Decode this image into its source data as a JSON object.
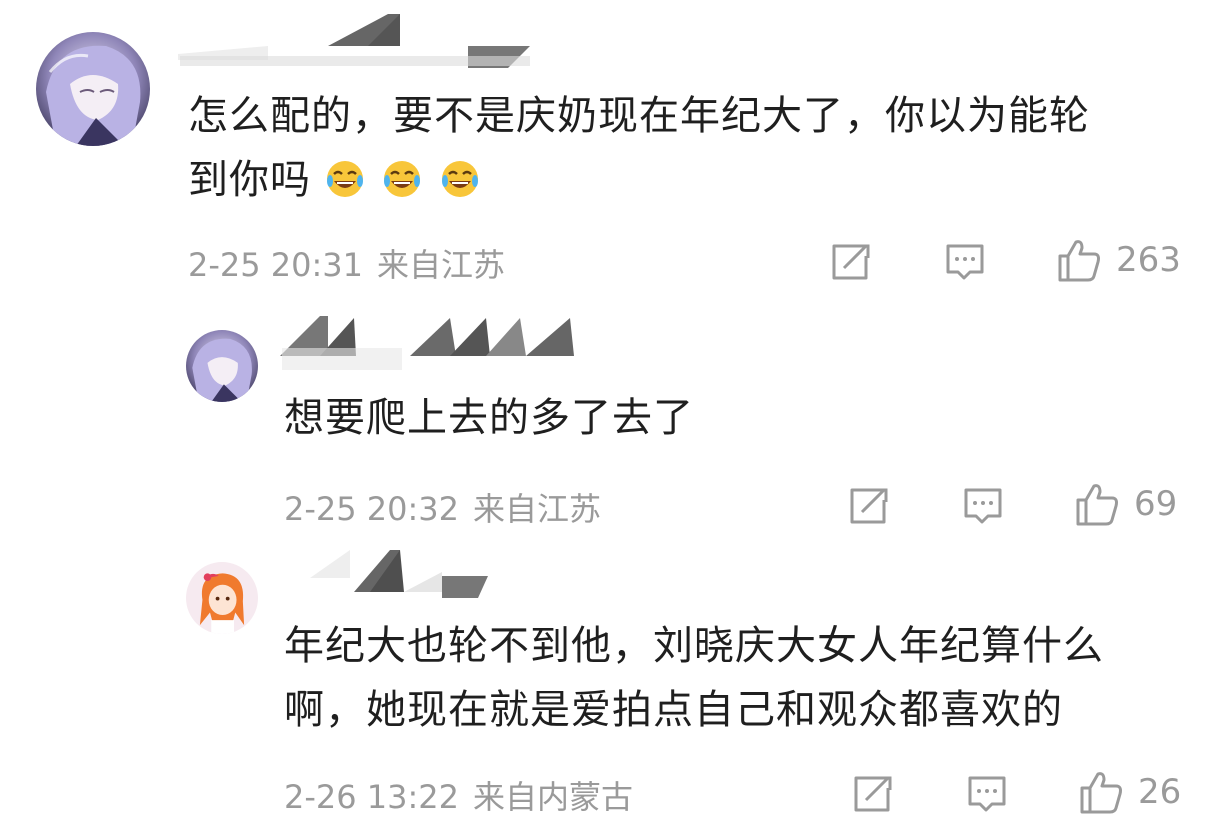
{
  "comments": [
    {
      "text_lines": [
        "怎么配的，要不是庆奶现在年纪大了，你以为能轮",
        "到你吗"
      ],
      "emoji": [
        "laugh-cry",
        "laugh-cry",
        "laugh-cry"
      ],
      "time": "2-25 20:31",
      "location": "来自江苏",
      "likes": "263"
    },
    {
      "text_lines": [
        "想要爬上去的多了去了"
      ],
      "time": "2-25 20:32",
      "location": "来自江苏",
      "likes": "69"
    },
    {
      "text_lines": [
        "年纪大也轮不到他，刘晓庆大女人年纪算什么",
        "啊，她现在就是爱拍点自己和观众都喜欢的"
      ],
      "time": "2-26 13:22",
      "location": "来自内蒙古",
      "likes": "26"
    }
  ],
  "icons": {
    "share": "share-icon",
    "reply": "comment-icon",
    "like": "thumbs-up-icon"
  },
  "colors": {
    "meta_gray": "#9a9a9a",
    "text": "#1f1f1f"
  }
}
